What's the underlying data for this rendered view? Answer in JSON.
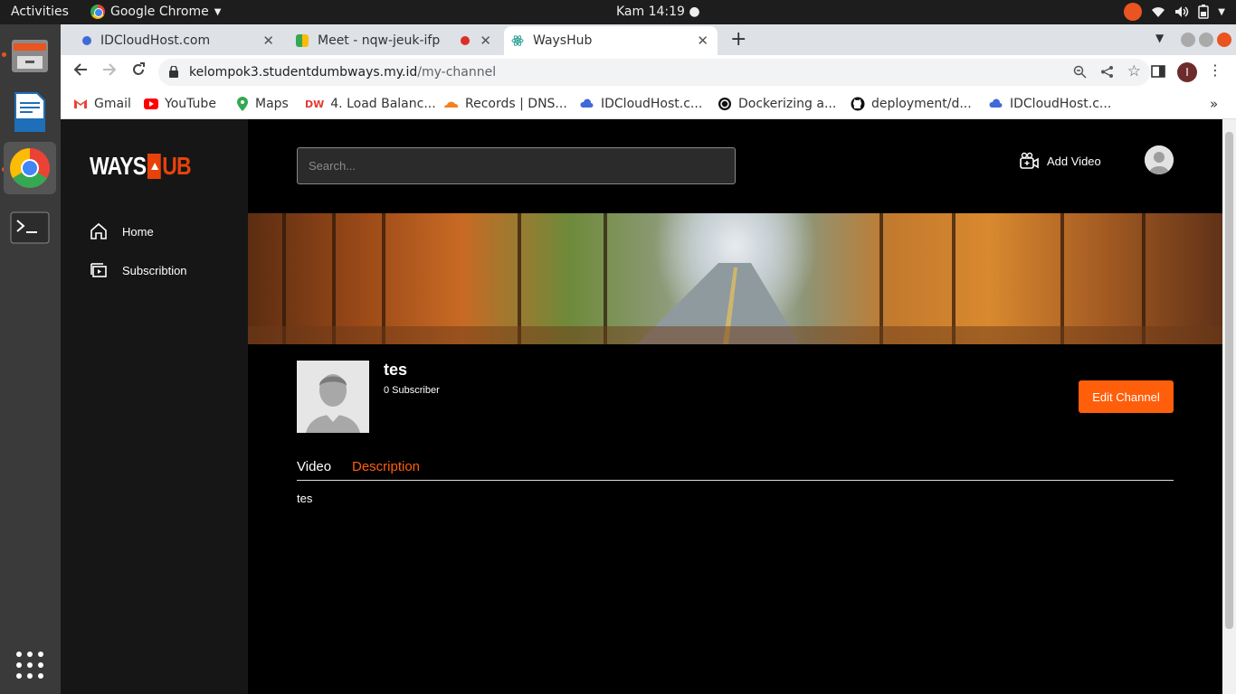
{
  "system": {
    "activities": "Activities",
    "app_name": "Google Chrome",
    "clock": "Kam 14:19 ●"
  },
  "browser": {
    "tabs": [
      {
        "label": "IDCloudHost.com"
      },
      {
        "label": "Meet - nqw-jeuk-ifp"
      },
      {
        "label": "WaysHub"
      }
    ],
    "url_host": "kelompok3.studentdumbways.my.id",
    "url_path": "/my-channel",
    "profile_initial": "I",
    "bookmarks": [
      {
        "label": "Gmail",
        "icon": "gmail-icon",
        "color": "#ea4335"
      },
      {
        "label": "YouTube",
        "icon": "youtube-icon",
        "color": "#ff0000"
      },
      {
        "label": "Maps",
        "icon": "maps-icon",
        "color": "#34a853"
      },
      {
        "label": "4. Load Balanc...",
        "icon": "dumbways-icon",
        "color": "#e53935"
      },
      {
        "label": "Records | DNS...",
        "icon": "cloudflare-icon",
        "color": "#f48120"
      },
      {
        "label": "IDCloudHost.c...",
        "icon": "idcloudhost-icon",
        "color": "#3f6ad8"
      },
      {
        "label": "Dockerizing a...",
        "icon": "circle-icon",
        "color": "#111111"
      },
      {
        "label": "deployment/d...",
        "icon": "github-icon",
        "color": "#111111"
      },
      {
        "label": "IDCloudHost.c...",
        "icon": "idcloudhost-icon",
        "color": "#3f6ad8"
      }
    ]
  },
  "app": {
    "logo_left": "WAYS",
    "logo_right": "UB",
    "nav": [
      {
        "label": "Home",
        "icon": "home-icon"
      },
      {
        "label": "Subscribtion",
        "icon": "subscription-icon"
      }
    ],
    "search_placeholder": "Search...",
    "add_video_label": "Add Video",
    "channel": {
      "name": "tes",
      "subscribers": "0 Subscriber",
      "edit_label": "Edit Channel"
    },
    "tabs": [
      {
        "label": "Video",
        "active": false
      },
      {
        "label": "Description",
        "active": true
      }
    ],
    "description": "tes",
    "accent_color": "#ff5e0a"
  }
}
